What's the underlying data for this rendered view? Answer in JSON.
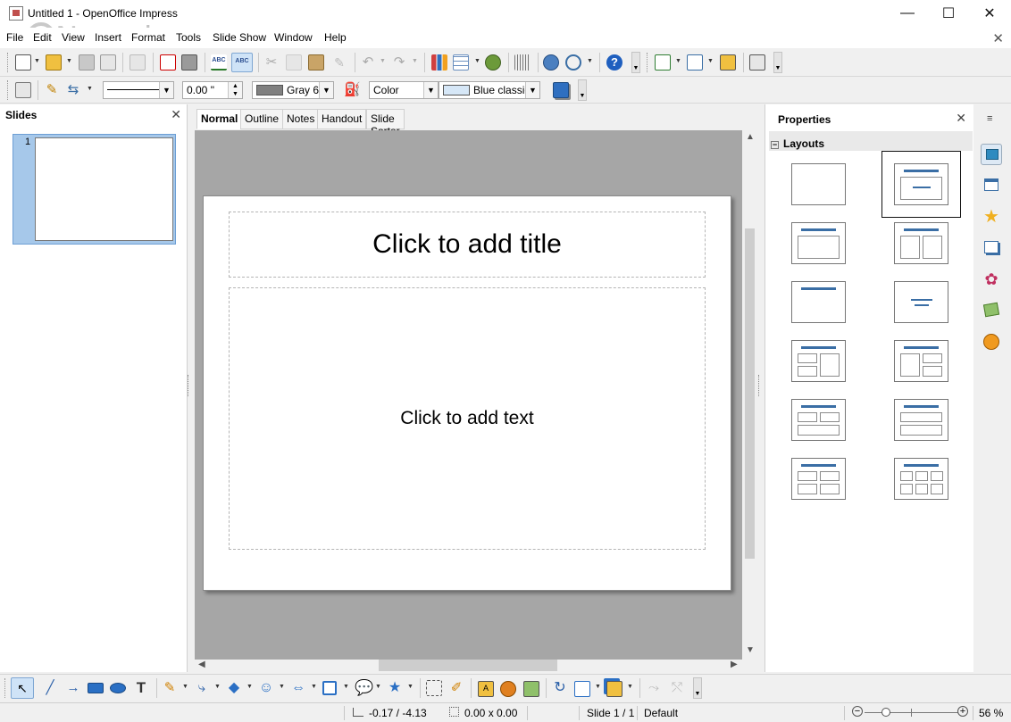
{
  "window": {
    "title": "Untitled 1 - OpenOffice Impress",
    "watermark": "Neowin",
    "minimize_glyph": "—",
    "maximize_glyph": "☐",
    "close_glyph": "✕"
  },
  "menu": {
    "items": [
      "File",
      "Edit",
      "View",
      "Insert",
      "Format",
      "Tools",
      "Slide Show",
      "Window",
      "Help"
    ],
    "close_doc": "✕"
  },
  "toolbar2": {
    "line_width": "0.00 \"",
    "line_color": "Gray 6",
    "area_style": "Color",
    "area_fill": "Blue classic"
  },
  "slides_panel": {
    "title": "Slides",
    "close": "✕",
    "slide_number": "1"
  },
  "view_tabs": [
    "Normal",
    "Outline",
    "Notes",
    "Handout",
    "Slide Sorter"
  ],
  "active_tab": "Normal",
  "slide": {
    "title_placeholder": "Click to add title",
    "body_placeholder": "Click to add text"
  },
  "properties": {
    "title": "Properties",
    "close": "✕",
    "section": "Layouts",
    "section_toggle": "−",
    "layouts": [
      "blank",
      "title-content",
      "title-content-2",
      "title-2-content",
      "title-only",
      "centered-text",
      "title-2-content-and-content",
      "title-content-and-2-content",
      "title-2-content-over-content",
      "title-content-over-content",
      "title-4-content",
      "title-6-content"
    ],
    "selected_layout": "title-content"
  },
  "sidebar_icons": [
    "properties-icon",
    "slide-transition-icon",
    "animation-icon",
    "master-pages-icon",
    "styles-icon",
    "gallery-icon",
    "navigator-icon"
  ],
  "status": {
    "position": "-0.17 / -4.13",
    "size": "0.00 x 0.00",
    "slide": "Slide 1 / 1",
    "master": "Default",
    "zoom": "56 %",
    "zoom_level": 0.56
  },
  "colors": {
    "accent": "#3a6ea5",
    "canvas_bg": "#a6a6a6",
    "line_color_swatch": "#808080",
    "area_fill_swatch": "#d6e7f7",
    "selection_bg": "#a6c8ea"
  }
}
